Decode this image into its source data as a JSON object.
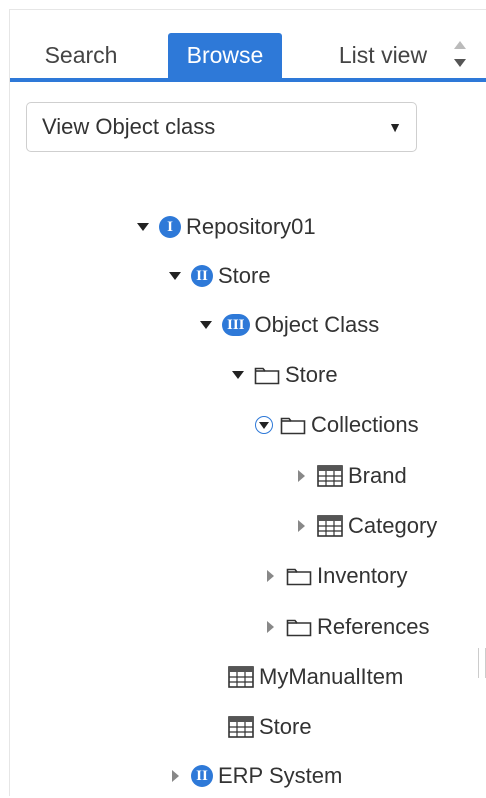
{
  "tabs": [
    {
      "label": "Search",
      "active": false
    },
    {
      "label": "Browse",
      "active": true
    },
    {
      "label": "List view",
      "active": false
    }
  ],
  "view_select": {
    "value": "View Object class",
    "caret": "▼"
  },
  "tree": [
    {
      "label": "Repository01",
      "toggle": "expanded",
      "icon": "level-1-badge-icon",
      "badge": "I"
    },
    {
      "label": "Store",
      "toggle": "expanded",
      "icon": "level-2-badge-icon",
      "badge": "II"
    },
    {
      "label": "Object Class",
      "toggle": "expanded",
      "icon": "level-3-badge-icon",
      "badge": "III"
    },
    {
      "label": "Store",
      "toggle": "expanded",
      "icon": "folder-icon"
    },
    {
      "label": "Collections",
      "toggle": "expanded-selected",
      "icon": "folder-icon"
    },
    {
      "label": "Brand",
      "toggle": "collapsed",
      "icon": "table-icon"
    },
    {
      "label": "Category",
      "toggle": "collapsed",
      "icon": "table-icon"
    },
    {
      "label": "Inventory",
      "toggle": "collapsed",
      "icon": "folder-icon"
    },
    {
      "label": "References",
      "toggle": "collapsed",
      "icon": "folder-icon"
    },
    {
      "label": "MyManualItem",
      "toggle": "none",
      "icon": "table-icon"
    },
    {
      "label": "Store",
      "toggle": "none",
      "icon": "table-icon"
    },
    {
      "label": "ERP System",
      "toggle": "collapsed",
      "icon": "level-2-badge-icon",
      "badge": "II"
    }
  ],
  "colors": {
    "accent": "#2e79d8",
    "text": "#333333",
    "border": "#cfcfcf"
  }
}
